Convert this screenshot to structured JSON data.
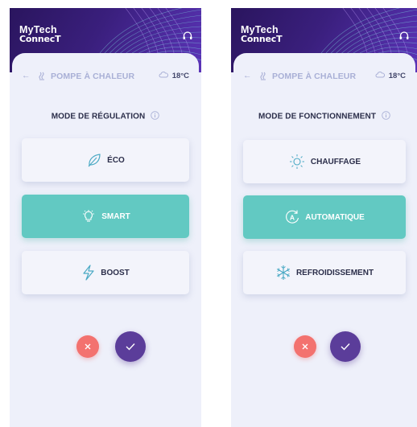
{
  "screens": [
    {
      "app_name_line1": "MyTech",
      "app_name_line2": "ConnecT",
      "back_arrow": "←",
      "breadcrumb_title": "POMPE À CHALEUR",
      "temperature": "18°C",
      "section_title": "MODE DE RÉGULATION",
      "options": [
        {
          "label": "ÉCO",
          "icon": "leaf-icon",
          "active": false
        },
        {
          "label": "SMART",
          "icon": "lightbulb-icon",
          "active": true
        },
        {
          "label": "BOOST",
          "icon": "lightning-icon",
          "active": false
        }
      ]
    },
    {
      "app_name_line1": "MyTech",
      "app_name_line2": "ConnecT",
      "back_arrow": "←",
      "breadcrumb_title": "POMPE À CHALEUR",
      "temperature": "18°C",
      "section_title": "MODE DE FONCTIONNEMENT",
      "options": [
        {
          "label": "CHAUFFAGE",
          "icon": "sun-icon",
          "active": false
        },
        {
          "label": "AUTOMATIQUE",
          "icon": "auto-mode-icon",
          "active": true
        },
        {
          "label": "REFROIDISSEMENT",
          "icon": "snowflake-icon",
          "active": false
        }
      ]
    }
  ],
  "colors": {
    "header_dark": "#2a155e",
    "header_light": "#5b34b8",
    "active_option": "#62c9c2",
    "cancel": "#f3726f",
    "confirm": "#5b3d9a",
    "background": "#eef0fa"
  }
}
